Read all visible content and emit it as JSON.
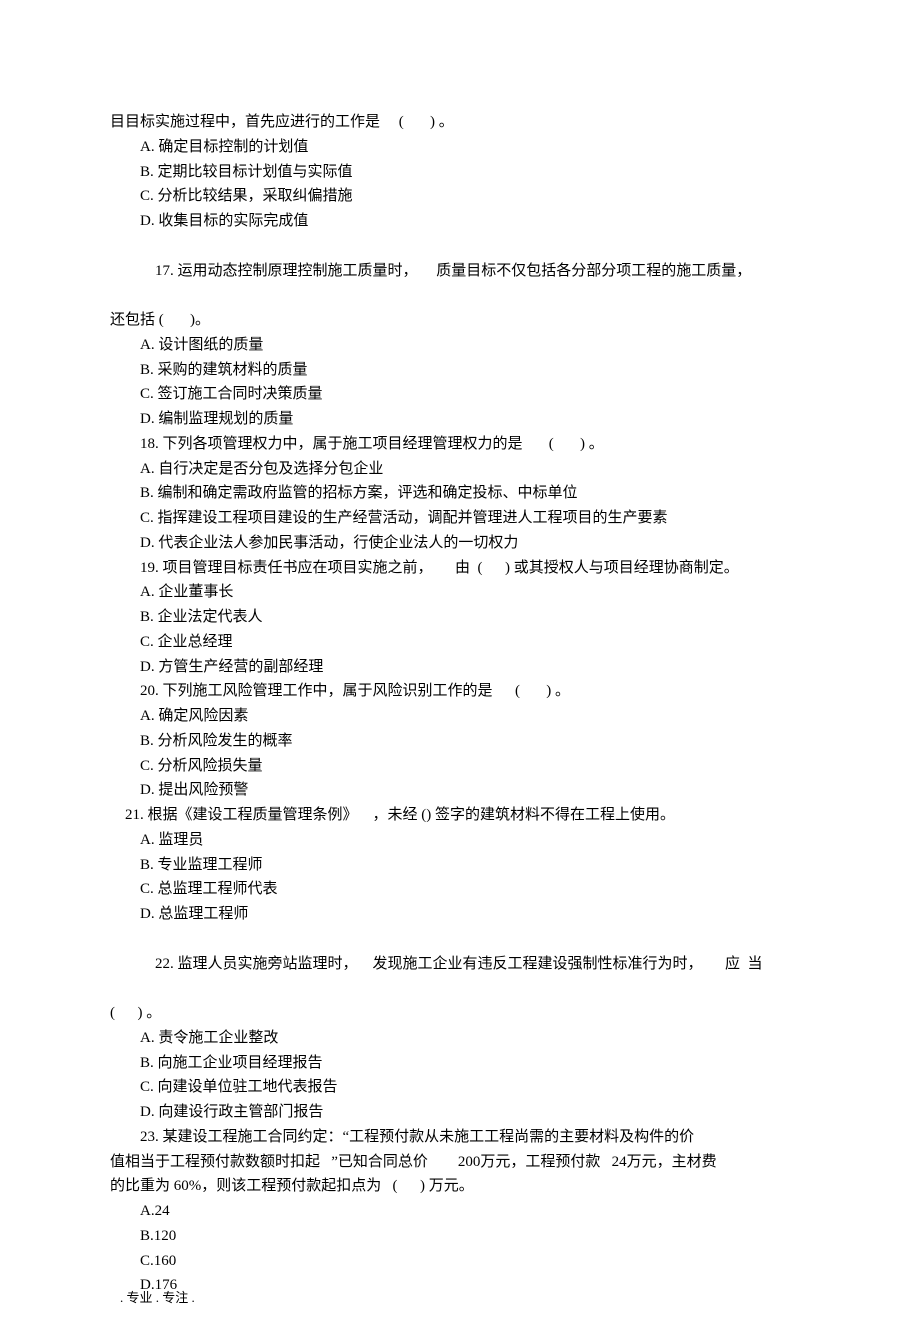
{
  "fragment_top": "目目标实施过程中，首先应进行的工作是     (       ) 。",
  "q16_opts": {
    "A": "A. 确定目标控制的计划值",
    "B": "B. 定期比较目标计划值与实际值",
    "C": "C. 分析比较结果，采取纠偏措施",
    "D": "D. 收集目标的实际完成值"
  },
  "q17_stem_a": "17. 运用动态控制原理控制施工质量时，",
  "q17_stem_b": "质量目标不仅包括各分部分项工程的施工质量，",
  "q17_stem_c": "还包括 (       )。",
  "q17_opts": {
    "A": "A. 设计图纸的质量",
    "B": "B. 采购的建筑材料的质量",
    "C": "C. 签订施工合同时决策质量",
    "D": "D. 编制监理规划的质量"
  },
  "q18_stem": "18. 下列各项管理权力中，属于施工项目经理管理权力的是       (       ) 。",
  "q18_opts": {
    "A": "A. 自行决定是否分包及选择分包企业",
    "B": "B. 编制和确定需政府监管的招标方案，评选和确定投标、中标单位",
    "C": "C. 指挥建设工程项目建设的生产经营活动，调配并管理进人工程项目的生产要素",
    "D": "D. 代表企业法人参加民事活动，行使企业法人的一切权力"
  },
  "q19_stem": "19. 项目管理目标责任书应在项目实施之前，      由  (      ) 或其授权人与项目经理协商制定。",
  "q19_opts": {
    "A": "A. 企业董事长",
    "B": "B. 企业法定代表人",
    "C": "C. 企业总经理",
    "D": "D. 方管生产经营的副部经理"
  },
  "q20_stem": "20. 下列施工风险管理工作中，属于风险识别工作的是      (       ) 。",
  "q20_opts": {
    "A": "A. 确定风险因素",
    "B": "B. 分析风险发生的概率",
    "C": "C. 分析风险损失量",
    "D": "D. 提出风险预警"
  },
  "q21_stem": "21. 根据《建设工程质量管理条例》    ，未经 () 签字的建筑材料不得在工程上使用。",
  "q21_opts": {
    "A": "A. 监理员",
    "B": "B. 专业监理工程师",
    "C": "C. 总监理工程师代表",
    "D": "D. 总监理工程师"
  },
  "q22_stem_a": "22. 监理人员实施旁站监理时，",
  "q22_stem_b": "发现施工企业有违反工程建设强制性标准行为时，",
  "q22_stem_c": "应  当",
  "q22_stem_d": "(      ) 。",
  "q22_opts": {
    "A": "A. 责令施工企业整改",
    "B": "B. 向施工企业项目经理报告",
    "C": "C. 向建设单位驻工地代表报告",
    "D": "D. 向建设行政主管部门报告"
  },
  "q23_stem_a": "23. 某建设工程施工合同约定：“工程预付款从未施工工程尚需的主要材料及构件的价",
  "q23_stem_b": "值相当于工程预付款数额时扣起   ”已知合同总价        200万元，工程预付款   24万元，主材费",
  "q23_stem_c": "的比重为 60%，则该工程预付款起扣点为   (      ) 万元。",
  "q23_opts": {
    "A": "A.24",
    "B": "B.120",
    "C": "C.160",
    "D": "D.176"
  },
  "footer": ". 专业 . 专注 ."
}
